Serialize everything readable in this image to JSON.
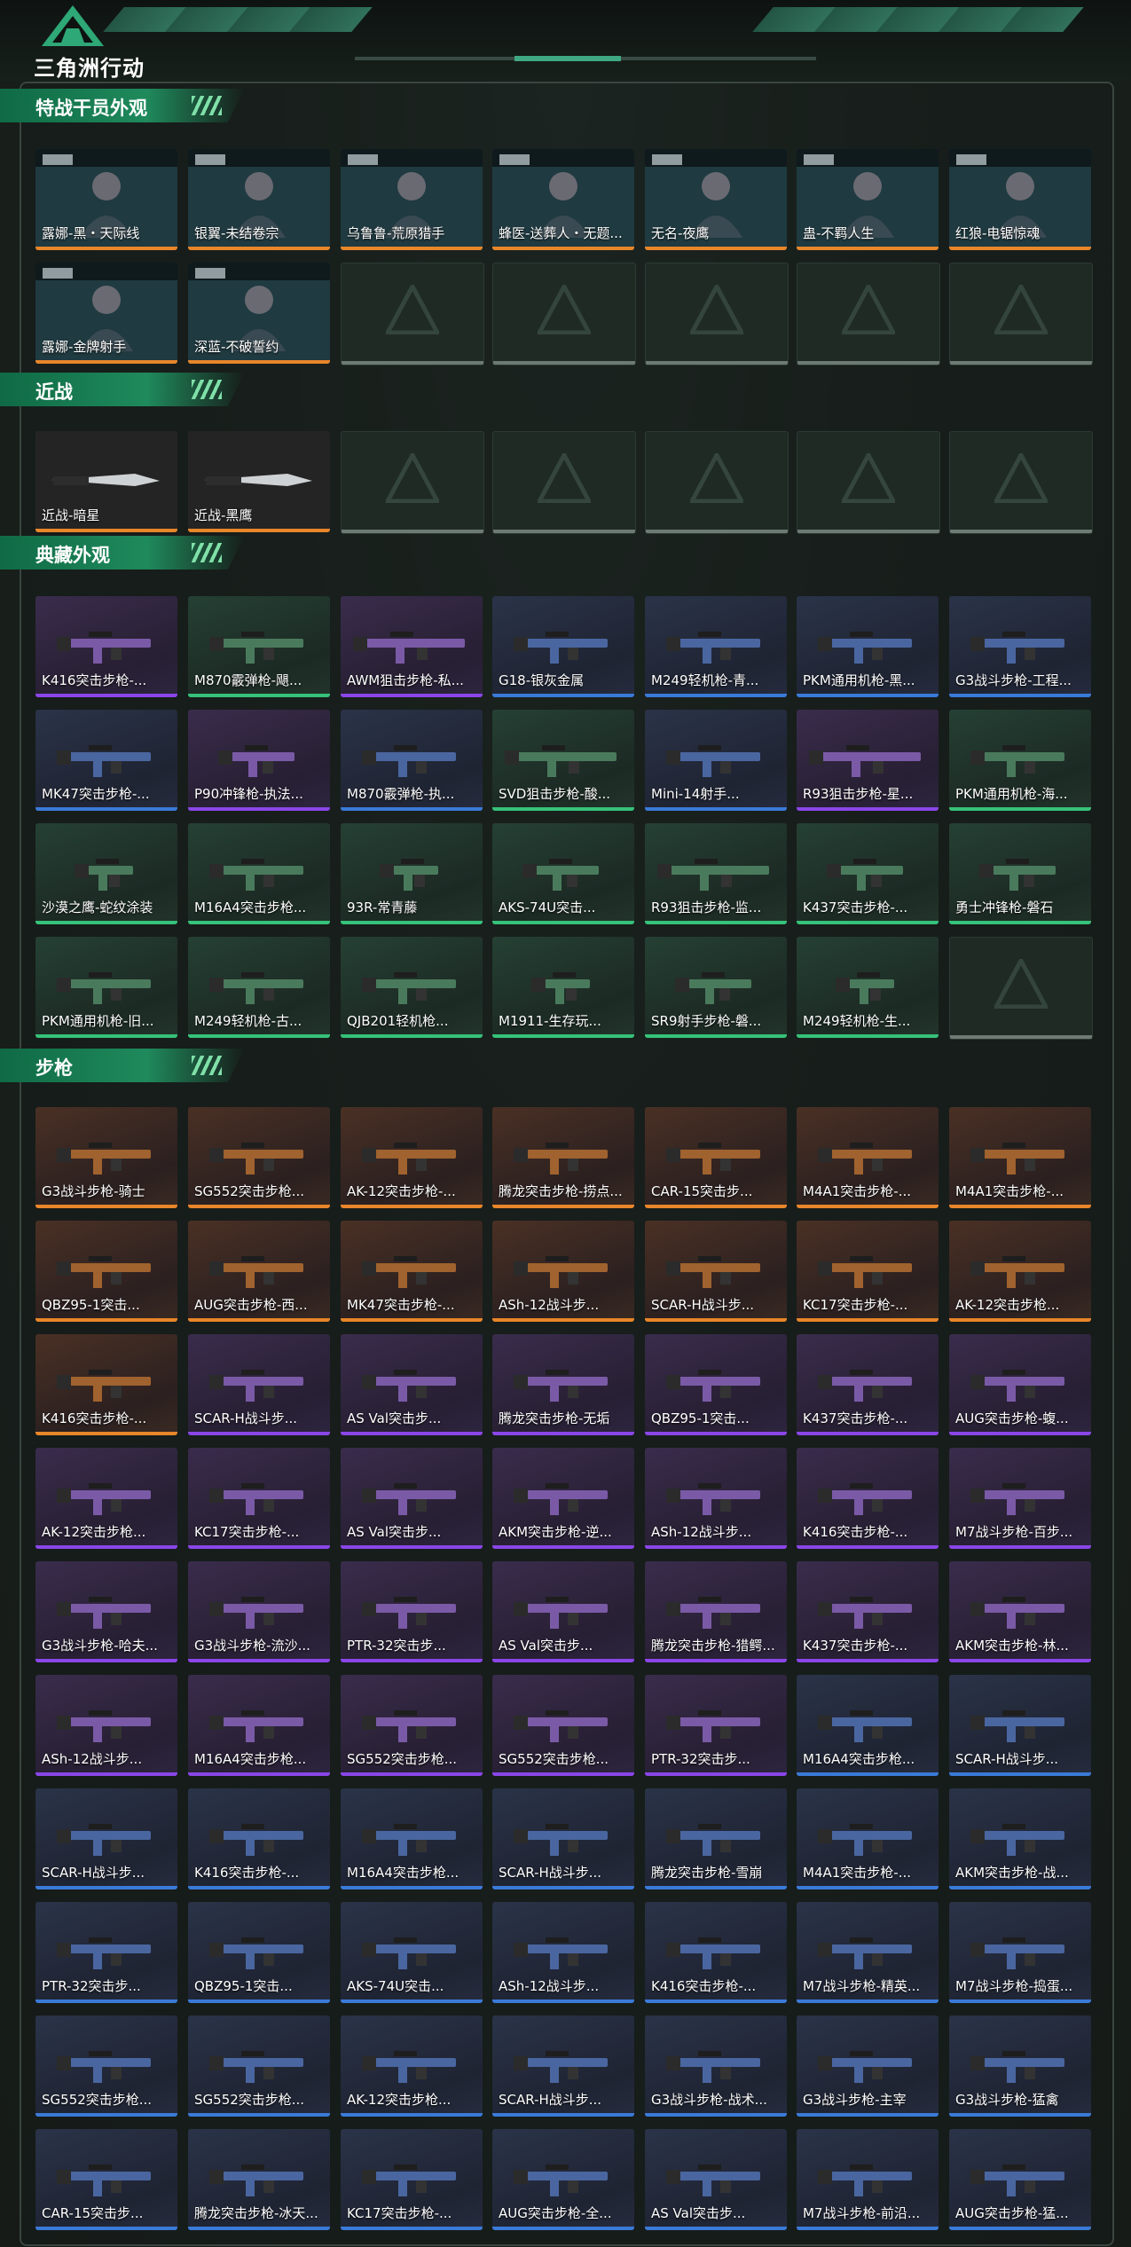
{
  "header": {
    "logo_text": "三角洲行动",
    "logo_icon": "delta-triangle-logo-icon",
    "accent": "#3fa884"
  },
  "colors": {
    "gold": "#e8862a",
    "purple": "#8a46e8",
    "blue": "#3a7ad8",
    "green": "#36c27a",
    "section_green": "#1f8a5c"
  },
  "sections": [
    {
      "title": "特战干员外观",
      "items": [
        {
          "label": "露娜-黑・天际线",
          "quality": "gold",
          "kind": "operator"
        },
        {
          "label": "银翼-未结卷宗",
          "quality": "gold",
          "kind": "operator"
        },
        {
          "label": "乌鲁鲁-荒原猎手",
          "quality": "gold",
          "kind": "operator"
        },
        {
          "label": "蜂医-送葬人・无题...",
          "quality": "gold",
          "kind": "operator"
        },
        {
          "label": "无名-夜鹰",
          "quality": "gold",
          "kind": "operator"
        },
        {
          "label": "蛊-不羁人生",
          "quality": "gold",
          "kind": "operator"
        },
        {
          "label": "红狼-电锯惊魂",
          "quality": "gold",
          "kind": "operator"
        },
        {
          "label": "露娜-金牌射手",
          "quality": "gold",
          "kind": "operator"
        },
        {
          "label": "深蓝-不破誓约",
          "quality": "gold",
          "kind": "operator"
        },
        {
          "label": "",
          "quality": "empty"
        },
        {
          "label": "",
          "quality": "empty"
        },
        {
          "label": "",
          "quality": "empty"
        },
        {
          "label": "",
          "quality": "empty"
        },
        {
          "label": "",
          "quality": "empty"
        }
      ]
    },
    {
      "title": "近战",
      "items": [
        {
          "label": "近战-暗星",
          "quality": "gold",
          "kind": "knife"
        },
        {
          "label": "近战-黑鹰",
          "quality": "gold",
          "kind": "knife"
        },
        {
          "label": "",
          "quality": "empty"
        },
        {
          "label": "",
          "quality": "empty"
        },
        {
          "label": "",
          "quality": "empty"
        },
        {
          "label": "",
          "quality": "empty"
        },
        {
          "label": "",
          "quality": "empty"
        }
      ]
    },
    {
      "title": "典藏外观",
      "items": [
        {
          "label": "K416突击步枪-...",
          "quality": "purple",
          "kind": "rifle"
        },
        {
          "label": "M870霰弹枪-飓...",
          "quality": "green",
          "kind": "rifle"
        },
        {
          "label": "AWM狙击步枪-私...",
          "quality": "purple",
          "kind": "sniper"
        },
        {
          "label": "G18-银灰金属",
          "quality": "blue",
          "kind": "shotgun"
        },
        {
          "label": "M249轻机枪-青...",
          "quality": "blue",
          "kind": "lmg"
        },
        {
          "label": "PKM通用机枪-黑...",
          "quality": "blue",
          "kind": "lmg"
        },
        {
          "label": "G3战斗步枪-工程...",
          "quality": "blue",
          "kind": "rifle"
        },
        {
          "label": "MK47突击步枪-...",
          "quality": "blue",
          "kind": "rifle"
        },
        {
          "label": "P90冲锋枪-执法...",
          "quality": "purple",
          "kind": "smg"
        },
        {
          "label": "M870霰弹枪-执...",
          "quality": "blue",
          "kind": "shotgun"
        },
        {
          "label": "SVD狙击步枪-酸...",
          "quality": "green",
          "kind": "sniper"
        },
        {
          "label": "Mini-14射手...",
          "quality": "blue",
          "kind": "rifle"
        },
        {
          "label": "R93狙击步枪-星...",
          "quality": "purple",
          "kind": "sniper"
        },
        {
          "label": "PKM通用机枪-海...",
          "quality": "green",
          "kind": "lmg"
        },
        {
          "label": "沙漠之鹰-蛇纹涂装",
          "quality": "green",
          "kind": "pistol"
        },
        {
          "label": "M16A4突击步枪...",
          "quality": "green",
          "kind": "rifle"
        },
        {
          "label": "93R-常青藤",
          "quality": "green",
          "kind": "pistol"
        },
        {
          "label": "AKS-74U突击...",
          "quality": "green",
          "kind": "smg"
        },
        {
          "label": "R93狙击步枪-监...",
          "quality": "green",
          "kind": "sniper"
        },
        {
          "label": "K437突击步枪-...",
          "quality": "green",
          "kind": "smg"
        },
        {
          "label": "勇士冲锋枪-磐石",
          "quality": "green",
          "kind": "smg"
        },
        {
          "label": "PKM通用机枪-旧...",
          "quality": "green",
          "kind": "lmg"
        },
        {
          "label": "M249轻机枪-古...",
          "quality": "green",
          "kind": "lmg"
        },
        {
          "label": "QJB201轻机枪...",
          "quality": "green",
          "kind": "lmg"
        },
        {
          "label": "M1911-生存玩...",
          "quality": "green",
          "kind": "pistol"
        },
        {
          "label": "SR9射手步枪-磐...",
          "quality": "green",
          "kind": "smg"
        },
        {
          "label": "M249轻机枪-生...",
          "quality": "green",
          "kind": "pistol"
        },
        {
          "label": "",
          "quality": "empty"
        }
      ]
    },
    {
      "title": "步枪",
      "items": [
        {
          "label": "G3战斗步枪-骑士",
          "quality": "gold",
          "kind": "rifle"
        },
        {
          "label": "SG552突击步枪...",
          "quality": "gold",
          "kind": "rifle"
        },
        {
          "label": "AK-12突击步枪-...",
          "quality": "gold",
          "kind": "rifle"
        },
        {
          "label": "腾龙突击步枪-捞点...",
          "quality": "gold",
          "kind": "rifle"
        },
        {
          "label": "CAR-15突击步...",
          "quality": "gold",
          "kind": "rifle"
        },
        {
          "label": "M4A1突击步枪-...",
          "quality": "gold",
          "kind": "rifle"
        },
        {
          "label": "M4A1突击步枪-...",
          "quality": "gold",
          "kind": "rifle"
        },
        {
          "label": "QBZ95-1突击...",
          "quality": "gold",
          "kind": "rifle"
        },
        {
          "label": "AUG突击步枪-西...",
          "quality": "gold",
          "kind": "rifle"
        },
        {
          "label": "MK47突击步枪-...",
          "quality": "gold",
          "kind": "rifle"
        },
        {
          "label": "ASh-12战斗步...",
          "quality": "gold",
          "kind": "rifle"
        },
        {
          "label": "SCAR-H战斗步...",
          "quality": "gold",
          "kind": "rifle"
        },
        {
          "label": "KC17突击步枪-...",
          "quality": "gold",
          "kind": "rifle"
        },
        {
          "label": "AK-12突击步枪...",
          "quality": "gold",
          "kind": "rifle"
        },
        {
          "label": "K416突击步枪-...",
          "quality": "gold",
          "kind": "rifle"
        },
        {
          "label": "SCAR-H战斗步...",
          "quality": "purple",
          "kind": "rifle"
        },
        {
          "label": "AS Val突击步...",
          "quality": "purple",
          "kind": "rifle"
        },
        {
          "label": "腾龙突击步枪-无垢",
          "quality": "purple",
          "kind": "rifle"
        },
        {
          "label": "QBZ95-1突击...",
          "quality": "purple",
          "kind": "rifle"
        },
        {
          "label": "K437突击步枪-...",
          "quality": "purple",
          "kind": "rifle"
        },
        {
          "label": "AUG突击步枪-蝮...",
          "quality": "purple",
          "kind": "rifle"
        },
        {
          "label": "AK-12突击步枪...",
          "quality": "purple",
          "kind": "rifle"
        },
        {
          "label": "KC17突击步枪-...",
          "quality": "purple",
          "kind": "rifle"
        },
        {
          "label": "AS Val突击步...",
          "quality": "purple",
          "kind": "rifle"
        },
        {
          "label": "AKM突击步枪-逆...",
          "quality": "purple",
          "kind": "rifle"
        },
        {
          "label": "ASh-12战斗步...",
          "quality": "purple",
          "kind": "rifle"
        },
        {
          "label": "K416突击步枪-...",
          "quality": "purple",
          "kind": "rifle"
        },
        {
          "label": "M7战斗步枪-百步...",
          "quality": "purple",
          "kind": "rifle"
        },
        {
          "label": "G3战斗步枪-哈夫...",
          "quality": "purple",
          "kind": "rifle"
        },
        {
          "label": "G3战斗步枪-流沙...",
          "quality": "purple",
          "kind": "rifle"
        },
        {
          "label": "PTR-32突击步...",
          "quality": "purple",
          "kind": "rifle"
        },
        {
          "label": "AS Val突击步...",
          "quality": "purple",
          "kind": "rifle"
        },
        {
          "label": "腾龙突击步枪-猎鳄...",
          "quality": "purple",
          "kind": "rifle"
        },
        {
          "label": "K437突击步枪-...",
          "quality": "purple",
          "kind": "rifle"
        },
        {
          "label": "AKM突击步枪-林...",
          "quality": "purple",
          "kind": "rifle"
        },
        {
          "label": "ASh-12战斗步...",
          "quality": "purple",
          "kind": "rifle"
        },
        {
          "label": "M16A4突击步枪...",
          "quality": "purple",
          "kind": "rifle"
        },
        {
          "label": "SG552突击步枪...",
          "quality": "purple",
          "kind": "rifle"
        },
        {
          "label": "SG552突击步枪...",
          "quality": "purple",
          "kind": "rifle"
        },
        {
          "label": "PTR-32突击步...",
          "quality": "purple",
          "kind": "rifle"
        },
        {
          "label": "M16A4突击步枪...",
          "quality": "blue",
          "kind": "rifle"
        },
        {
          "label": "SCAR-H战斗步...",
          "quality": "blue",
          "kind": "rifle"
        },
        {
          "label": "SCAR-H战斗步...",
          "quality": "blue",
          "kind": "rifle"
        },
        {
          "label": "K416突击步枪-...",
          "quality": "blue",
          "kind": "rifle"
        },
        {
          "label": "M16A4突击步枪...",
          "quality": "blue",
          "kind": "rifle"
        },
        {
          "label": "SCAR-H战斗步...",
          "quality": "blue",
          "kind": "rifle"
        },
        {
          "label": "腾龙突击步枪-雪崩",
          "quality": "blue",
          "kind": "rifle"
        },
        {
          "label": "M4A1突击步枪-...",
          "quality": "blue",
          "kind": "rifle"
        },
        {
          "label": "AKM突击步枪-战...",
          "quality": "blue",
          "kind": "rifle"
        },
        {
          "label": "PTR-32突击步...",
          "quality": "blue",
          "kind": "rifle"
        },
        {
          "label": "QBZ95-1突击...",
          "quality": "blue",
          "kind": "rifle"
        },
        {
          "label": "AKS-74U突击...",
          "quality": "blue",
          "kind": "rifle"
        },
        {
          "label": "ASh-12战斗步...",
          "quality": "blue",
          "kind": "rifle"
        },
        {
          "label": "K416突击步枪-...",
          "quality": "blue",
          "kind": "rifle"
        },
        {
          "label": "M7战斗步枪-精英...",
          "quality": "blue",
          "kind": "rifle"
        },
        {
          "label": "M7战斗步枪-捣蛋...",
          "quality": "blue",
          "kind": "rifle"
        },
        {
          "label": "SG552突击步枪...",
          "quality": "blue",
          "kind": "rifle"
        },
        {
          "label": "SG552突击步枪...",
          "quality": "blue",
          "kind": "rifle"
        },
        {
          "label": "AK-12突击步枪...",
          "quality": "blue",
          "kind": "rifle"
        },
        {
          "label": "SCAR-H战斗步...",
          "quality": "blue",
          "kind": "rifle"
        },
        {
          "label": "G3战斗步枪-战术...",
          "quality": "blue",
          "kind": "rifle"
        },
        {
          "label": "G3战斗步枪-主宰",
          "quality": "blue",
          "kind": "rifle"
        },
        {
          "label": "G3战斗步枪-猛禽",
          "quality": "blue",
          "kind": "rifle"
        },
        {
          "label": "CAR-15突击步...",
          "quality": "blue",
          "kind": "rifle"
        },
        {
          "label": "腾龙突击步枪-冰天...",
          "quality": "blue",
          "kind": "rifle"
        },
        {
          "label": "KC17突击步枪-...",
          "quality": "blue",
          "kind": "rifle"
        },
        {
          "label": "AUG突击步枪-全...",
          "quality": "blue",
          "kind": "rifle"
        },
        {
          "label": "AS Val突击步...",
          "quality": "blue",
          "kind": "rifle"
        },
        {
          "label": "M7战斗步枪-前沿...",
          "quality": "blue",
          "kind": "rifle"
        },
        {
          "label": "AUG突击步枪-猛...",
          "quality": "blue",
          "kind": "rifle"
        }
      ]
    }
  ]
}
